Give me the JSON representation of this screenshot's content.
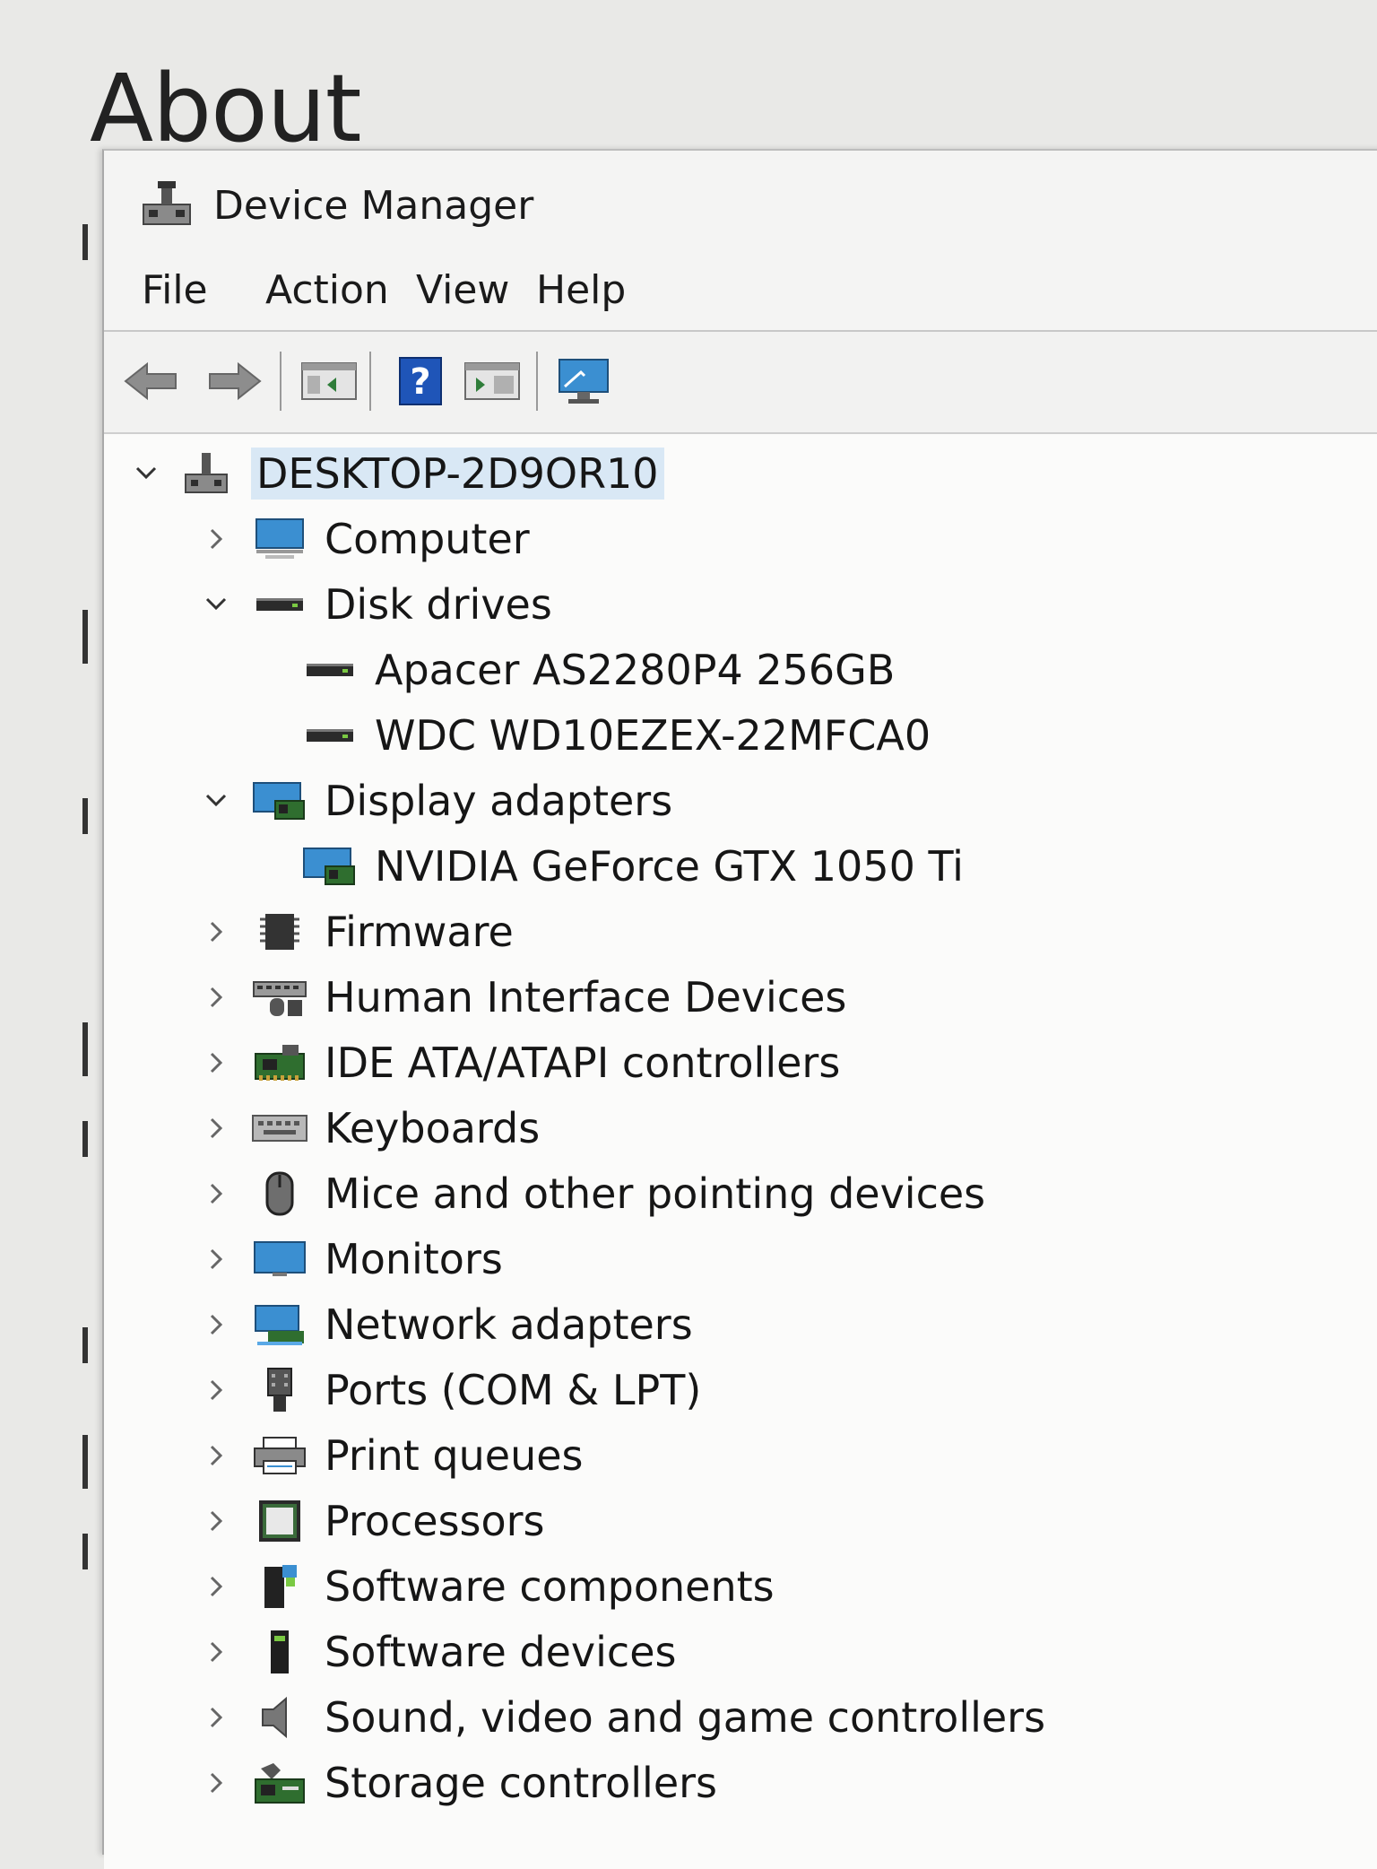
{
  "background": {
    "title": "About"
  },
  "window": {
    "title": "Device Manager",
    "menu": [
      "File",
      "Action",
      "View",
      "Help"
    ]
  },
  "tree": {
    "root": {
      "label": "DESKTOP-2D9OR10",
      "expanded": true
    },
    "categories": [
      {
        "label": "Computer",
        "icon": "computer-icon",
        "expanded": false
      },
      {
        "label": "Disk drives",
        "icon": "disk-drive-icon",
        "expanded": true,
        "children": [
          {
            "label": "Apacer AS2280P4 256GB",
            "icon": "disk-drive-icon"
          },
          {
            "label": "WDC WD10EZEX-22MFCA0",
            "icon": "disk-drive-icon"
          }
        ]
      },
      {
        "label": "Display adapters",
        "icon": "display-adapter-icon",
        "expanded": true,
        "children": [
          {
            "label": "NVIDIA GeForce GTX 1050 Ti",
            "icon": "display-adapter-icon"
          }
        ]
      },
      {
        "label": "Firmware",
        "icon": "firmware-icon",
        "expanded": false
      },
      {
        "label": "Human Interface Devices",
        "icon": "hid-icon",
        "expanded": false
      },
      {
        "label": "IDE ATA/ATAPI controllers",
        "icon": "ide-controller-icon",
        "expanded": false
      },
      {
        "label": "Keyboards",
        "icon": "keyboard-icon",
        "expanded": false
      },
      {
        "label": "Mice and other pointing devices",
        "icon": "mouse-icon",
        "expanded": false
      },
      {
        "label": "Monitors",
        "icon": "monitor-icon",
        "expanded": false
      },
      {
        "label": "Network adapters",
        "icon": "network-adapter-icon",
        "expanded": false
      },
      {
        "label": "Ports (COM & LPT)",
        "icon": "port-icon",
        "expanded": false
      },
      {
        "label": "Print queues",
        "icon": "printer-icon",
        "expanded": false
      },
      {
        "label": "Processors",
        "icon": "processor-icon",
        "expanded": false
      },
      {
        "label": "Software components",
        "icon": "software-component-icon",
        "expanded": false
      },
      {
        "label": "Software devices",
        "icon": "software-device-icon",
        "expanded": false
      },
      {
        "label": "Sound, video and game controllers",
        "icon": "speaker-icon",
        "expanded": false
      },
      {
        "label": "Storage controllers",
        "icon": "storage-controller-icon",
        "expanded": false
      }
    ]
  },
  "colors": {
    "selection": "#d9e8f5",
    "accent": "#3b8fd1"
  }
}
